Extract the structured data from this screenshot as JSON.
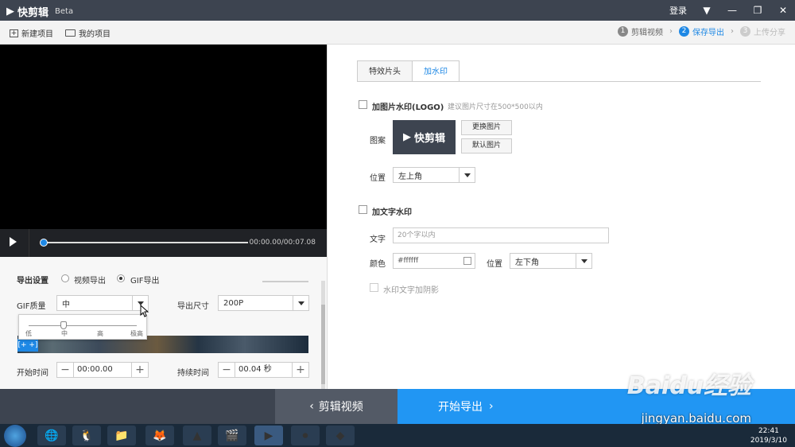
{
  "app": {
    "name": "快剪辑",
    "beta": "Beta",
    "login": "登录"
  },
  "toolbar": {
    "new_project": "新建项目",
    "my_projects": "我的项目"
  },
  "steps": [
    {
      "num": "1",
      "label": "剪辑视频",
      "state": "done"
    },
    {
      "num": "2",
      "label": "保存导出",
      "state": "active"
    },
    {
      "num": "3",
      "label": "上传分享",
      "state": "disabled"
    }
  ],
  "player": {
    "time": "00:00.00/00:07.08",
    "progress": 0
  },
  "export": {
    "settings_label": "导出设置",
    "video_export": "视频导出",
    "gif_export": "GIF导出",
    "selected": "GIF导出",
    "gif_quality_label": "GIF质量",
    "gif_quality_value": "中",
    "size_label": "导出尺寸",
    "size_value": "200P",
    "quality_levels": [
      "低",
      "中",
      "高",
      "极高"
    ],
    "start_label": "开始时间",
    "start_value": "00:00.00",
    "duration_label": "持续时间",
    "duration_value": "00.04 秒",
    "clip_marker": "[+ +]"
  },
  "bottom": {
    "edit_label": "剪辑视频",
    "export_label": "开始导出"
  },
  "watermark_panel": {
    "tabs": [
      "特效片头",
      "加水印"
    ],
    "active_tab": "加水印",
    "image_watermark_label": "加图片水印(LOGO)",
    "image_hint": "建议图片尺寸在500*500以内",
    "pattern_label": "图案",
    "change_image": "更换图片",
    "default_image": "默认图片",
    "position_label": "位置",
    "image_position": "左上角",
    "text_watermark_label": "加文字水印",
    "text_label": "文字",
    "text_placeholder": "20个字以内",
    "color_label": "颜色",
    "color_value": "#ffffff",
    "text_position_label": "位置",
    "text_position": "左下角",
    "shadow_label": "水印文字加阴影"
  },
  "taskbar": {
    "time": "22:41",
    "date": "2019/3/10"
  },
  "site_watermark": {
    "logo": "Baidu经验",
    "url": "jingyan.baidu.com"
  }
}
